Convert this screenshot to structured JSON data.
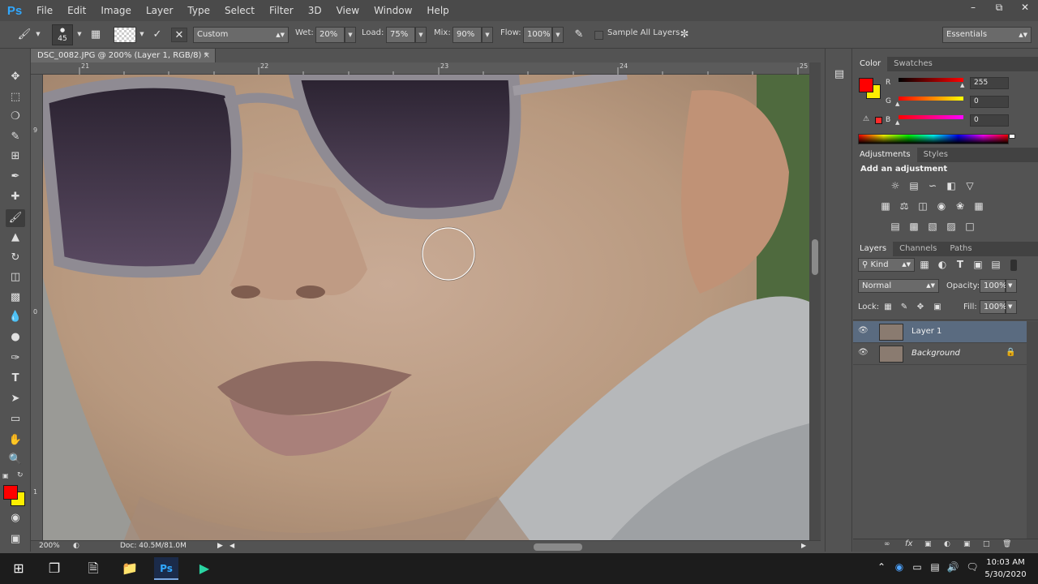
{
  "app": {
    "logo": "Ps",
    "menu": [
      "File",
      "Edit",
      "Image",
      "Layer",
      "Type",
      "Select",
      "Filter",
      "3D",
      "View",
      "Window",
      "Help"
    ],
    "window_controls": [
      "–",
      "⧉",
      "✕"
    ]
  },
  "options": {
    "brush_size": "45",
    "preset": "Custom",
    "wet_label": "Wet:",
    "wet_value": "20%",
    "load_label": "Load:",
    "load_value": "75%",
    "mix_label": "Mix:",
    "mix_value": "90%",
    "flow_label": "Flow:",
    "flow_value": "100%",
    "sample_all_label": "Sample All Layers",
    "workspace": "Essentials"
  },
  "document": {
    "tab_title": "DSC_0082.JPG @ 200% (Layer 1, RGB/8) *",
    "close_glyph": "×",
    "ruler_top_ticks": [
      "21",
      "22",
      "23",
      "24",
      "25"
    ],
    "ruler_left_ticks": [
      "9",
      "0",
      "1"
    ],
    "zoom": "200%",
    "doc_size": "Doc: 40.5M/81.0M"
  },
  "color_panel": {
    "tabs": [
      "Color",
      "Swatches"
    ],
    "foreground": "#ff0000",
    "background": "#ffee00",
    "channels": [
      {
        "label": "R",
        "value": "255",
        "level": 1.0
      },
      {
        "label": "G",
        "value": "0",
        "level": 0.0
      },
      {
        "label": "B",
        "value": "0",
        "level": 0.0
      }
    ]
  },
  "adjustments_panel": {
    "tabs": [
      "Adjustments",
      "Styles"
    ],
    "heading": "Add an adjustment",
    "icons": [
      "brightness-icon",
      "levels-icon",
      "curves-icon",
      "exposure-icon",
      "vibrance-icon",
      "hue-saturation-icon",
      "color-balance-icon",
      "black-white-icon",
      "photo-filter-icon",
      "channel-mixer-icon",
      "color-lookup-icon",
      "invert-icon",
      "posterize-icon",
      "threshold-icon",
      "selective-color-icon",
      "gradient-map-icon"
    ]
  },
  "layers_panel": {
    "tabs": [
      "Layers",
      "Channels",
      "Paths"
    ],
    "filter_kind": "Kind",
    "blend_mode": "Normal",
    "opacity_label": "Opacity:",
    "opacity_value": "100%",
    "lock_label": "Lock:",
    "fill_label": "Fill:",
    "fill_value": "100%",
    "layers": [
      {
        "name": "Layer 1",
        "selected": true,
        "locked": false
      },
      {
        "name": "Background",
        "selected": false,
        "locked": true
      }
    ]
  },
  "taskbar": {
    "time": "10:03 AM",
    "date": "5/30/2020"
  }
}
